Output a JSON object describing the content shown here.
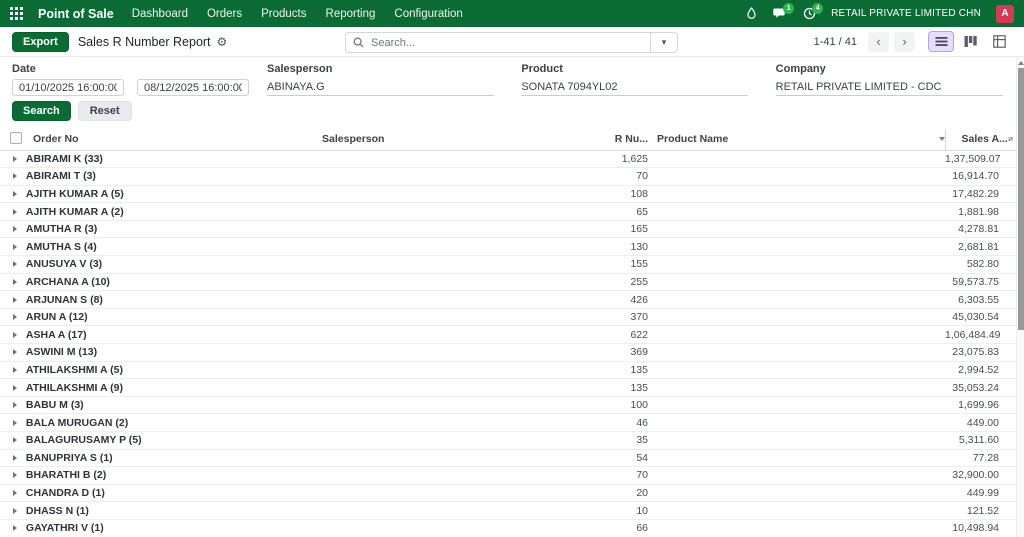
{
  "nav": {
    "brand": "Point of Sale",
    "items": [
      "Dashboard",
      "Orders",
      "Products",
      "Reporting",
      "Configuration"
    ],
    "chat_badge": "1",
    "activity_badge": "4",
    "company": "RETAIL PRIVATE LIMITED CHN",
    "avatar_letter": "A"
  },
  "control_panel": {
    "export_label": "Export",
    "title": "Sales R Number Report",
    "search_placeholder": "Search...",
    "pager_text": "1-41 / 41"
  },
  "filters": {
    "date_label": "Date",
    "date_from": "01/10/2025 16:00:00",
    "date_to": "08/12/2025 16:00:00",
    "salesperson_label": "Salesperson",
    "salesperson_value": "ABINAYA.G",
    "product_label": "Product",
    "product_value": "SONATA 7094YL02",
    "company_label": "Company",
    "company_value": "RETAIL PRIVATE LIMITED - CDC",
    "search_button": "Search",
    "reset_button": "Reset"
  },
  "table": {
    "headers": {
      "order_no": "Order No",
      "salesperson": "Salesperson",
      "r_number": "R Nu...",
      "product_name": "Product Name",
      "sales_amount": "Sales A..."
    },
    "rows": [
      {
        "name": "ABIRAMI K (33)",
        "r_number": "1,625",
        "sales_amount": "1,37,509.07"
      },
      {
        "name": "ABIRAMI T (3)",
        "r_number": "70",
        "sales_amount": "16,914.70"
      },
      {
        "name": "AJITH KUMAR A (5)",
        "r_number": "108",
        "sales_amount": "17,482.29"
      },
      {
        "name": "AJITH KUMAR A (2)",
        "r_number": "65",
        "sales_amount": "1,881.98"
      },
      {
        "name": "AMUTHA R (3)",
        "r_number": "165",
        "sales_amount": "4,278.81"
      },
      {
        "name": "AMUTHA S (4)",
        "r_number": "130",
        "sales_amount": "2,681.81"
      },
      {
        "name": "ANUSUYA V (3)",
        "r_number": "155",
        "sales_amount": "582.80"
      },
      {
        "name": "ARCHANA A (10)",
        "r_number": "255",
        "sales_amount": "59,573.75"
      },
      {
        "name": "ARJUNAN S (8)",
        "r_number": "426",
        "sales_amount": "6,303.55"
      },
      {
        "name": "ARUN A (12)",
        "r_number": "370",
        "sales_amount": "45,030.54"
      },
      {
        "name": "ASHA A (17)",
        "r_number": "622",
        "sales_amount": "1,06,484.49"
      },
      {
        "name": "ASWINI M (13)",
        "r_number": "369",
        "sales_amount": "23,075.83"
      },
      {
        "name": "ATHILAKSHMI A (5)",
        "r_number": "135",
        "sales_amount": "2,994.52"
      },
      {
        "name": "ATHILAKSHMI A (9)",
        "r_number": "135",
        "sales_amount": "35,053.24"
      },
      {
        "name": "BABU M (3)",
        "r_number": "100",
        "sales_amount": "1,699.96"
      },
      {
        "name": "BALA MURUGAN (2)",
        "r_number": "46",
        "sales_amount": "449.00"
      },
      {
        "name": "BALAGURUSAMY P (5)",
        "r_number": "35",
        "sales_amount": "5,311.60"
      },
      {
        "name": "BANUPRIYA S (1)",
        "r_number": "54",
        "sales_amount": "77.28"
      },
      {
        "name": "BHARATHI B (2)",
        "r_number": "70",
        "sales_amount": "32,900.00"
      },
      {
        "name": "CHANDRA D (1)",
        "r_number": "20",
        "sales_amount": "449.99"
      },
      {
        "name": "DHASS N (1)",
        "r_number": "10",
        "sales_amount": "121.52"
      },
      {
        "name": "GAYATHRI V (1)",
        "r_number": "66",
        "sales_amount": "10,498.94"
      }
    ]
  },
  "icons": {
    "gear": "⚙",
    "caret_down": "▾",
    "prev": "‹",
    "next": "›"
  },
  "colors": {
    "navbar_green": "#0a6b35",
    "badge_green": "#31b24f",
    "avatar_red": "#d63952",
    "active_view_bg": "#e6def9",
    "active_view_border": "#b2a1ea"
  }
}
